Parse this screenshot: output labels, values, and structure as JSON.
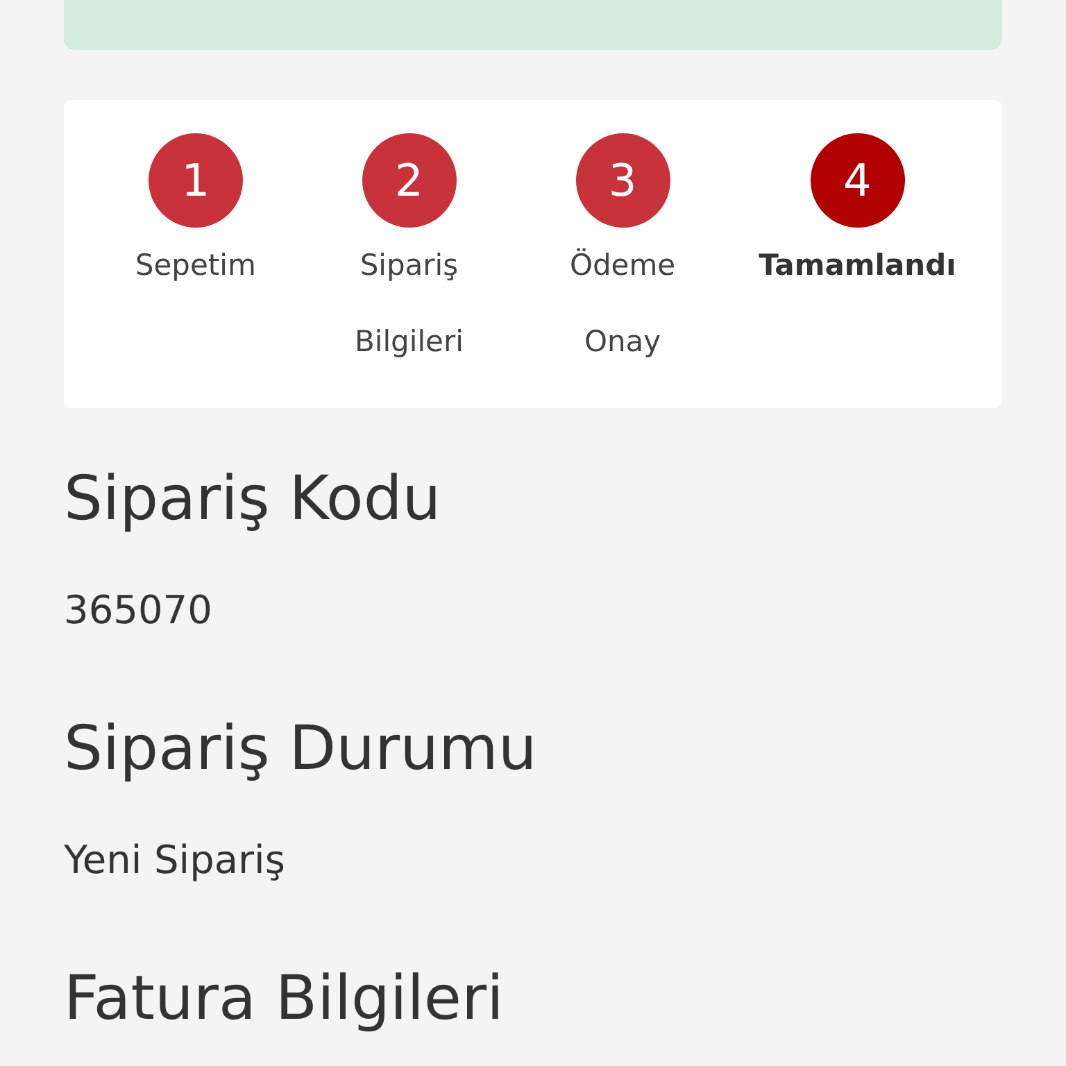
{
  "steps": [
    {
      "number": "1",
      "label": "Sepetim",
      "selected": false
    },
    {
      "number": "2",
      "label": "Sipariş Bilgileri",
      "selected": false
    },
    {
      "number": "3",
      "label": "Ödeme Onay",
      "selected": false
    },
    {
      "number": "4",
      "label": "Tamamlandı",
      "selected": true
    }
  ],
  "sections": [
    {
      "heading": "Sipariş Kodu",
      "value": "365070"
    },
    {
      "heading": "Sipariş Durumu",
      "value": "Yeni Sipariş"
    },
    {
      "heading": "Fatura Bilgileri"
    }
  ]
}
